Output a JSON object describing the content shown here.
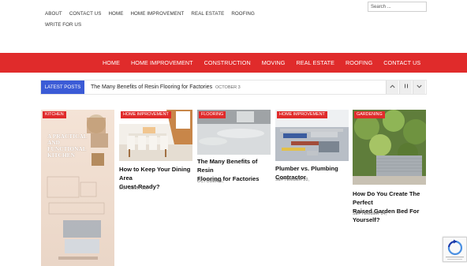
{
  "top_links": {
    "row1": [
      "ABOUT",
      "CONTACT US",
      "HOME",
      "HOME IMPROVEMENT",
      "REAL ESTATE",
      "ROOFING"
    ],
    "row2": [
      "WRITE FOR US"
    ]
  },
  "search": {
    "placeholder": "Search ..."
  },
  "main_nav": [
    "HOME",
    "HOME IMPROVEMENT",
    "CONSTRUCTION",
    "MOVING",
    "REAL ESTATE",
    "ROOFING",
    "CONTACT US"
  ],
  "ticker": {
    "label": "LATEST POSTS",
    "headline": "The Many Benefits of Resin Flooring for Factories",
    "date": "OCTOBER 3",
    "controls": [
      "^",
      "||",
      "v"
    ]
  },
  "cards": [
    {
      "tag": "KITCHEN",
      "infographic_lines": [
        "A PRACTICAL",
        "AND FUNCTIONAL",
        "KITCHEN"
      ]
    },
    {
      "tag": "HOME IMPROVEMENT",
      "title_lines": [
        "How to Keep Your Dining Area",
        "Guest-Ready?"
      ],
      "date": "OCTOBER 15,"
    },
    {
      "tag": "FLOORING",
      "title_lines": [
        "The Many Benefits of Resin",
        "Flooring for Factories"
      ],
      "date": "OCTOBER 3,"
    },
    {
      "tag": "HOME IMPROVEMENT",
      "title_lines": [
        "Plumber vs. Plumbing Contractor"
      ],
      "date": "SEPTEMBER 20,"
    },
    {
      "tag": "GARDENING",
      "title_lines": [
        "How Do You Create The Perfect",
        "Raised Garden Bed For Yourself?"
      ],
      "date": "SEPTEMBER 14,"
    }
  ],
  "colors": {
    "accent_red": "#e02b2b",
    "ticker_blue": "#3b5bd6"
  }
}
